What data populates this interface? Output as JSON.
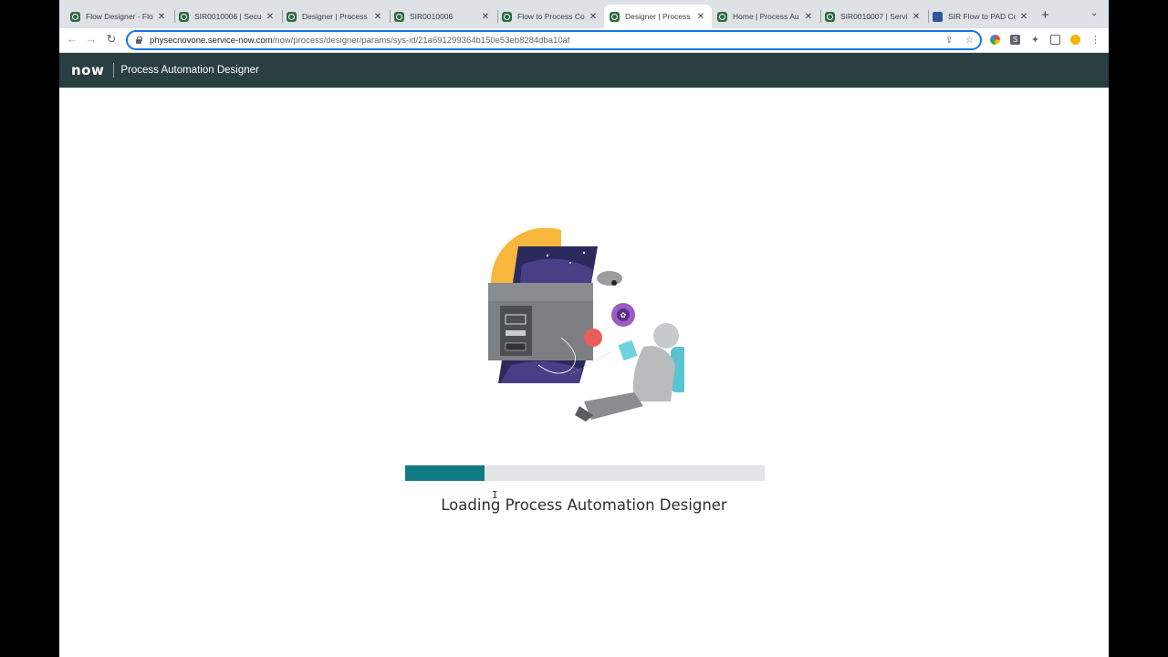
{
  "browser": {
    "tabs": [
      {
        "title": "Flow Designer - Flo",
        "active": false,
        "icon": "servicenow-favicon"
      },
      {
        "title": "SIR0010006 | Secu",
        "active": false,
        "icon": "servicenow-favicon"
      },
      {
        "title": "Designer | Process",
        "active": false,
        "icon": "servicenow-favicon"
      },
      {
        "title": "SIR0010006",
        "active": false,
        "icon": "servicenow-favicon"
      },
      {
        "title": "Flow to Process Co",
        "active": false,
        "icon": "servicenow-favicon"
      },
      {
        "title": "Designer | Process",
        "active": true,
        "icon": "servicenow-favicon"
      },
      {
        "title": "Home | Process Au",
        "active": false,
        "icon": "servicenow-favicon"
      },
      {
        "title": "SIR0010007 | Servi",
        "active": false,
        "icon": "servicenow-favicon"
      },
      {
        "title": "SIR Flow to PAD Co",
        "active": false,
        "icon": "word-favicon"
      }
    ],
    "new_tab_label": "+",
    "url_host": "physecnovone.service-now.com",
    "url_path": "/now/process/designer/params/sys-id/21a691299364b150e53eb8284dba10af"
  },
  "app": {
    "logo": "now",
    "title": "Process Automation Designer"
  },
  "loading": {
    "progress": 0.22,
    "message": "Loading Process Automation Designer"
  },
  "colors": {
    "header_bg": "#293e40",
    "progress_fill": "#107b84",
    "progress_track": "#e2e4e5"
  }
}
